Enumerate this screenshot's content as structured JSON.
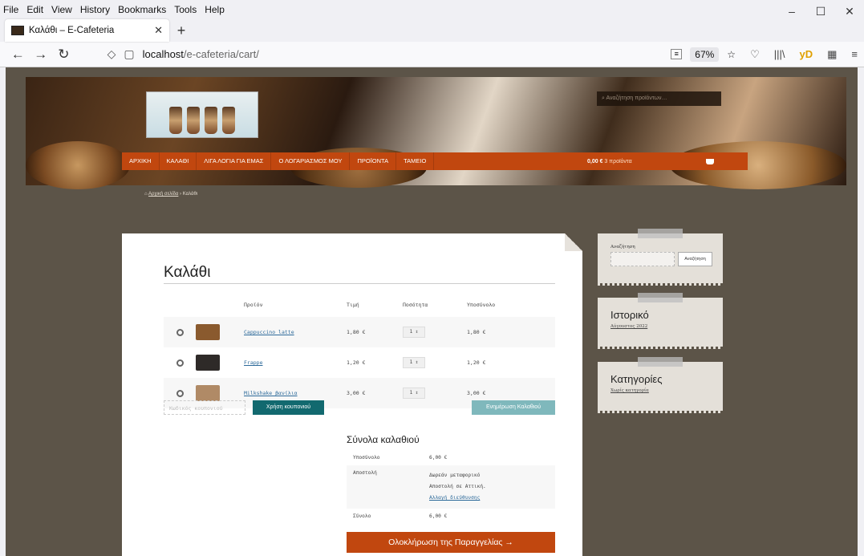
{
  "browser": {
    "menu": [
      "File",
      "Edit",
      "View",
      "History",
      "Bookmarks",
      "Tools",
      "Help"
    ],
    "tab_title": "Καλάθι – E-Cafeteria",
    "url_host": "localhost",
    "url_path": "/e-cafeteria/cart/",
    "zoom": "67%"
  },
  "site": {
    "search_placeholder": "Αναζήτηση προϊόντων…",
    "nav": [
      "ΑΡΧΙΚΗ",
      "ΚΑΛΑΘΙ",
      "ΛΙΓΑ ΛΟΓΙΑ ΓΙΑ ΕΜΑΣ",
      "Ο ΛΟΓΑΡΙΑΣΜΟΣ ΜΟΥ",
      "ΠΡΟΪΟΝΤΑ",
      "ΤΑΜΕΙΟ"
    ],
    "cart_amount": "0,00 €",
    "cart_items": "3 προϊόντα",
    "breadcrumb_home": "Αρχική σελίδα",
    "breadcrumb_current": "Καλάθι"
  },
  "cart": {
    "title": "Καλάθι",
    "headers": {
      "product": "Προϊόν",
      "price": "Τιμή",
      "quantity": "Ποσότητα",
      "subtotal": "Υποσύνολο"
    },
    "items": [
      {
        "name": "Cappuccino latte",
        "price": "1,80 €",
        "qty": "1",
        "subtotal": "1,80 €",
        "color": "#8a5a2e"
      },
      {
        "name": "Frappe",
        "price": "1,20 €",
        "qty": "1",
        "subtotal": "1,20 €",
        "color": "#2e2a28"
      },
      {
        "name": "Milkshake βανίλια",
        "price": "3,00 €",
        "qty": "1",
        "subtotal": "3,00 €",
        "color": "#b08a66"
      }
    ],
    "coupon_placeholder": "Κωδικός κουπονιού",
    "apply_coupon": "Χρήση κουπονιού",
    "update_cart": "Ενημέρωση Καλαθιού"
  },
  "totals": {
    "title": "Σύνολα καλαθιού",
    "subtotal_label": "Υποσύνολο",
    "subtotal_value": "6,00 €",
    "shipping_label": "Αποστολή",
    "shipping_free": "Δωρεάν μεταφορικό",
    "shipping_to": "Αποστολή σε Αττική.",
    "change_address": "Αλλαγή διεύθυνσης",
    "total_label": "Σύνολο",
    "total_value": "6,00 €",
    "checkout": "Ολοκλήρωση της Παραγγελίας →"
  },
  "sidebar": {
    "search_label": "Αναζήτηση",
    "search_button": "Αναζήτηση",
    "history_title": "Ιστορικό",
    "history_link": "Αύγουστος 2022",
    "categories_title": "Κατηγορίες",
    "categories_link": "Χωρίς κατηγορία"
  },
  "colors": {
    "accent": "#c1470f",
    "teal": "#12696f",
    "background": "#5c5448"
  }
}
